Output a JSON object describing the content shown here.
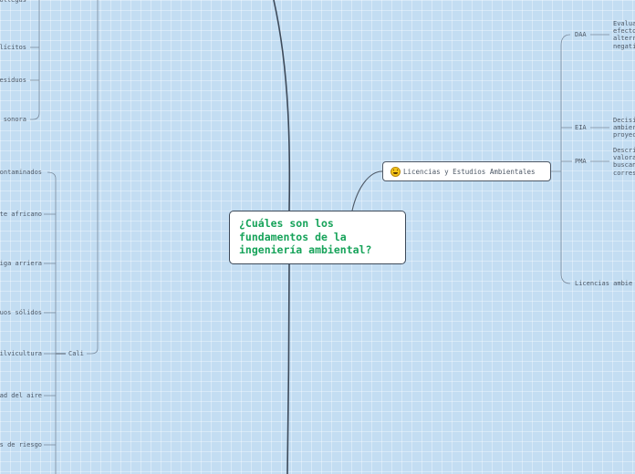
{
  "central": {
    "title": "¿Cuáles son los fundamentos de la ingeniería ambiental?"
  },
  "topic": {
    "label": "Licencias y Estudios Ambientales",
    "emoji": "grinning-face-icon"
  },
  "right_branches": {
    "daa": {
      "label": "DAA",
      "desc": "Evalua efecto alterr negati"
    },
    "eia": {
      "label": "EIA",
      "desc": "Decisi ambier proyec"
    },
    "pma": {
      "label": "PMA",
      "desc": "Descri valora buscan corres"
    },
    "licencias": {
      "label": "Licencias ambie"
    }
  },
  "left_upper": [
    "ollegas",
    "ilícitos",
    "esiduos",
    "sonora"
  ],
  "left_lower": [
    "ontaminados",
    "te africano",
    "iga arriera",
    "uos sólidos",
    "ilvicultura",
    "ad del aire",
    "s de riesgo"
  ],
  "cali": {
    "label": "Cali"
  },
  "colors": {
    "background": "#c3ddf2",
    "line": "#3d4a5a",
    "thin_line": "#7a8a9c",
    "central_text": "#17a35a"
  }
}
